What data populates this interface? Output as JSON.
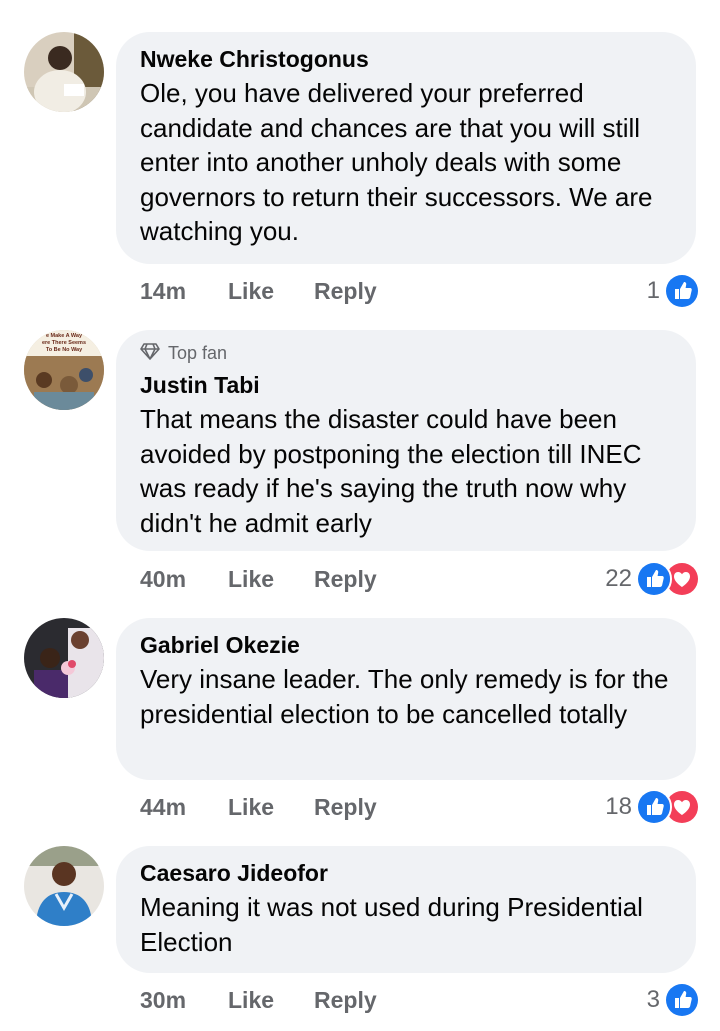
{
  "comments": [
    {
      "author": "Nweke Christogonus",
      "top_fan": false,
      "text": "Ole, you have delivered your preferred candidate and chances are that you will still enter into another unholy deals with some governors to return their successors. We are watching you.",
      "time": "14m",
      "like_label": "Like",
      "reply_label": "Reply",
      "reaction_count": "1",
      "reactions": [
        "like-icon"
      ]
    },
    {
      "author": "Justin Tabi",
      "top_fan": true,
      "top_fan_label": "Top fan",
      "avatar_text": [
        "e Make A Way",
        "ere There Seems",
        "To Be No Way"
      ],
      "text": "That means the disaster could have been avoided by postponing the election till INEC was ready if he's saying the truth now why didn't he admit early",
      "time": "40m",
      "like_label": "Like",
      "reply_label": "Reply",
      "reaction_count": "22",
      "reactions": [
        "like-icon",
        "love-icon"
      ]
    },
    {
      "author": "Gabriel Okezie",
      "top_fan": false,
      "text": "Very insane leader. The only remedy is for the presidential election to be cancelled totally",
      "time": "44m",
      "like_label": "Like",
      "reply_label": "Reply",
      "reaction_count": "18",
      "reactions": [
        "like-icon",
        "love-icon"
      ]
    },
    {
      "author": "Caesaro Jideofor",
      "top_fan": false,
      "text": "Meaning it was not used during Presidential Election",
      "time": "30m",
      "like_label": "Like",
      "reply_label": "Reply",
      "reaction_count": "3",
      "reactions": [
        "like-icon"
      ]
    }
  ],
  "colors": {
    "bubble": "#f0f2f5",
    "meta": "#65676b",
    "like_blue": "#1877f2",
    "love_red": "#f33e58"
  }
}
